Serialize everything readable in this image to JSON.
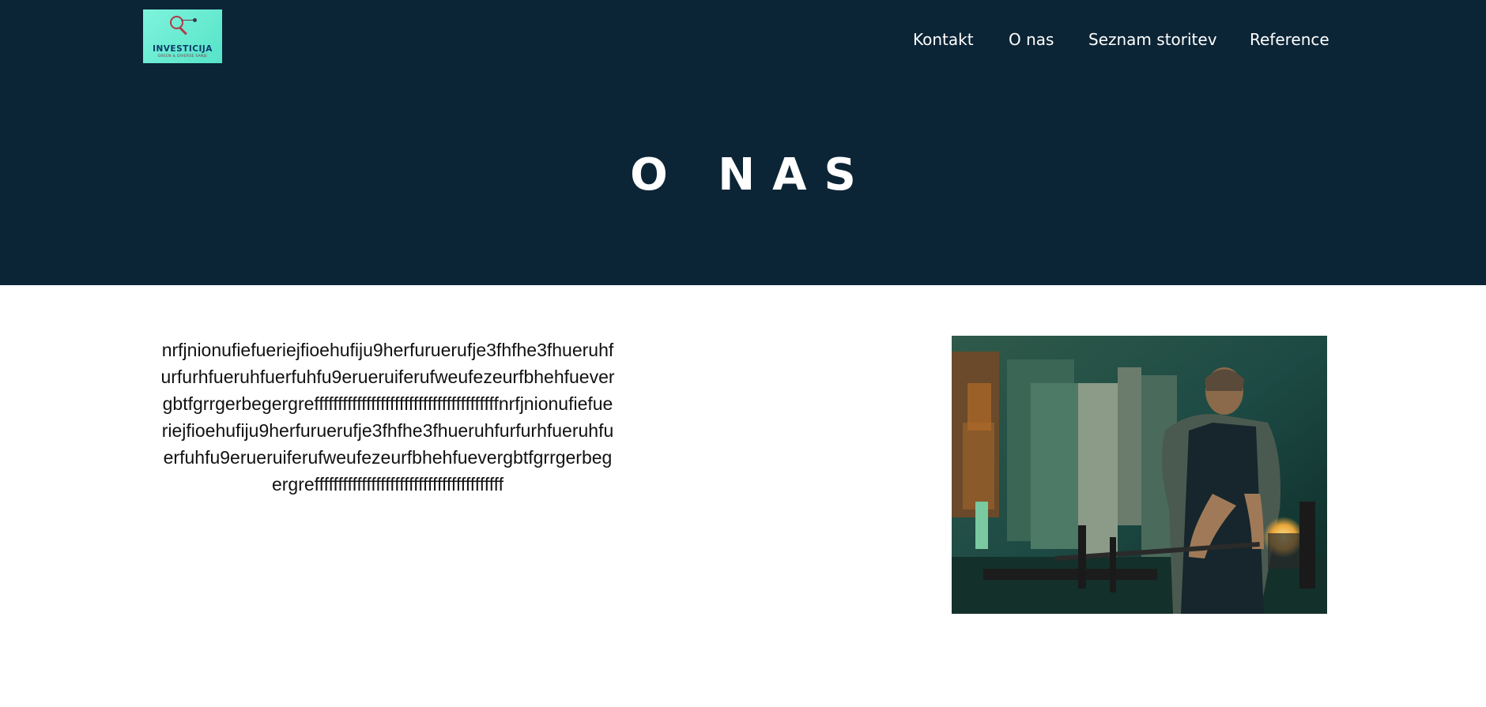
{
  "header": {
    "logo": {
      "name": "INVESTICIJA",
      "tagline": "GREEN & DIVERSE SANJE",
      "icon": "magnifier-icon"
    },
    "nav": [
      {
        "label": "Kontakt"
      },
      {
        "label": "O nas"
      },
      {
        "label": "Seznam storitev"
      },
      {
        "label": "Reference"
      }
    ],
    "title": "O NAS"
  },
  "content": {
    "paragraph": "nrfjnionufiefueriejfioehufiju9herfuruerufje3fhfhe3fhueruhfurfurhfueruhfuerfuhfu9erueruiferufweufezeurfbhehfuevergbtfgrrgerbegergrefffffffffffffffffffffffffffffffffffffffnrfjnionufiefueriejfioehufiju9herfuruerufje3fhfhe3fhueruhfurfurhfueruhfuerfuhfu9erueruiferufweufezeurfbhehfuevergbtfgrrgerbegergreffffffffffffffffffffffffffffffffffffffff",
    "image": "glassblower-workshop-photo"
  },
  "colors": {
    "header_bg": "#0c2536",
    "logo_bg": "#6eeed6",
    "nav_text": "#ffffff"
  }
}
